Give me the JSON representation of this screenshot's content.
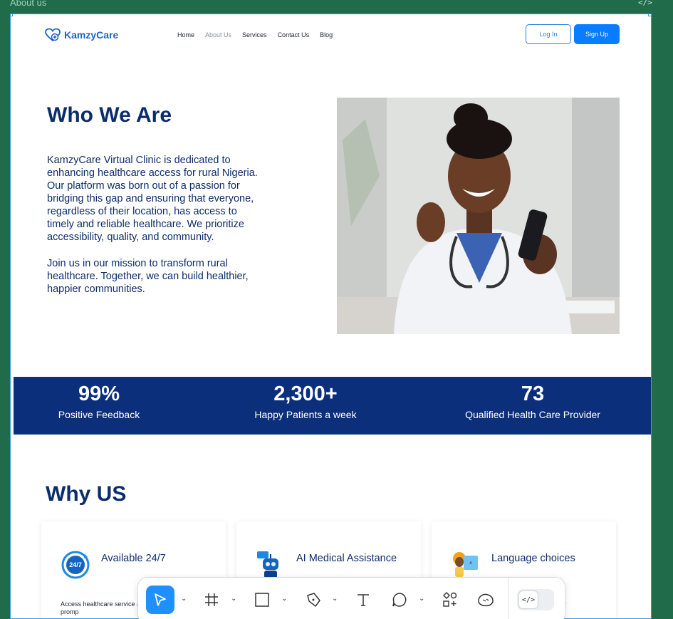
{
  "frame": {
    "label": "About us",
    "code_icon": "</>"
  },
  "nav": {
    "brand": "KamzyCare",
    "links": [
      "Home",
      "About Us",
      "Services",
      "Contact Us",
      "Blog"
    ],
    "active_index": 1,
    "login": "Log In",
    "signup": "Sign Up"
  },
  "hero": {
    "title": "Who We Are",
    "paragraph1": "KamzyCare Virtual Clinic is dedicated to enhancing healthcare access for rural Nigeria. Our platform was born out of a passion for bridging this gap and ensuring that everyone, regardless of their location, has access to timely and reliable healthcare. We prioritize accessibility, quality, and community.",
    "paragraph2": "Join us in our mission to transform rural healthcare. Together, we can build healthier, happier communities."
  },
  "stats": [
    {
      "value": "99%",
      "label": "Positive Feedback"
    },
    {
      "value": "2,300+",
      "label": "Happy Patients a week"
    },
    {
      "value": "73",
      "label": "Qualified Health Care Provider"
    }
  ],
  "why": {
    "title": "Why US",
    "cards": [
      {
        "title": "Available 24/7",
        "icon": "clock-24-7-icon",
        "text": "Access healthcare service anywhere, ensuring promp"
      },
      {
        "title": "AI Medical Assistance",
        "icon": "robot-icon",
        "text": ""
      },
      {
        "title": "Language choices",
        "icon": "language-person-icon",
        "text": "y"
      }
    ]
  },
  "toolbar": {
    "tools": [
      "move-tool",
      "frame-tool",
      "rectangle-tool",
      "pen-tool",
      "text-tool",
      "comment-tool",
      "actions-tool",
      "ai-tool"
    ],
    "dev_mode_label": "</>"
  },
  "colors": {
    "brand_blue": "#0b2f7a",
    "accent": "#0a7cff",
    "canvas_bg": "#1f6b4a"
  }
}
